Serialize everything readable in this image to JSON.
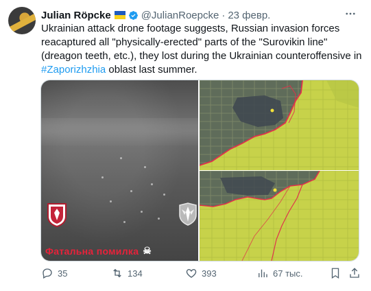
{
  "author": {
    "name": "Julian Röpcke",
    "handle": "@JulianRoepcke",
    "separator": "·",
    "date": "23 февр."
  },
  "tweet": {
    "text_before": "Ukrainian attack drone footage suggests, Russian invasion forces reacaptured all \"physically-erected\" parts of the \"Surovikin line\" (dreagon teeth, etc.), they lost during the Ukrainian counteroffensive in ",
    "hashtag": "#Zaporizhzhia",
    "text_after": " oblast last summer."
  },
  "video": {
    "caption": "Фатальна помилка",
    "caption_icon": "skull-icon"
  },
  "actions": {
    "replies": "35",
    "reposts": "134",
    "likes": "393",
    "views": "67 тыс."
  },
  "colors": {
    "accent": "#1d9bf0",
    "secondary_text": "#536471",
    "verified": "#1d9bf0",
    "map_ukraine_green": "#c8d44a",
    "front_line_red": "#e0324a",
    "caption_red": "#e8223a"
  },
  "icons": [
    "reply-icon",
    "repost-icon",
    "like-icon",
    "views-icon",
    "bookmark-icon",
    "share-icon",
    "more-icon",
    "verified-icon"
  ]
}
